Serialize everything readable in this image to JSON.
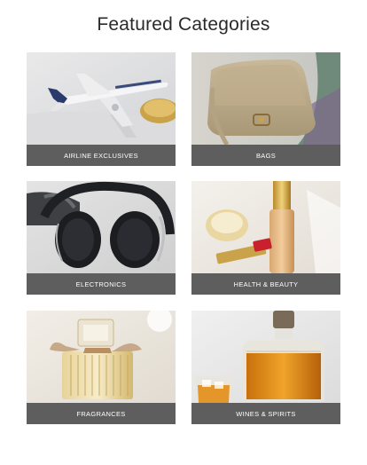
{
  "page": {
    "title": "Featured Categories"
  },
  "categories": [
    {
      "label": "AIRLINE EXCLUSIVES",
      "icon": "airplane-model-image"
    },
    {
      "label": "BAGS",
      "icon": "handbag-image"
    },
    {
      "label": "ELECTRONICS",
      "icon": "headphones-image"
    },
    {
      "label": "HEALTH & BEAUTY",
      "icon": "cosmetics-image"
    },
    {
      "label": "FRAGRANCES",
      "icon": "perfume-bottle-image"
    },
    {
      "label": "WINES & SPIRITS",
      "icon": "whisky-decanter-image"
    }
  ],
  "colors": {
    "label_bar": "#5e5e5e",
    "label_text": "#ffffff",
    "title_text": "#2a2a2a"
  }
}
